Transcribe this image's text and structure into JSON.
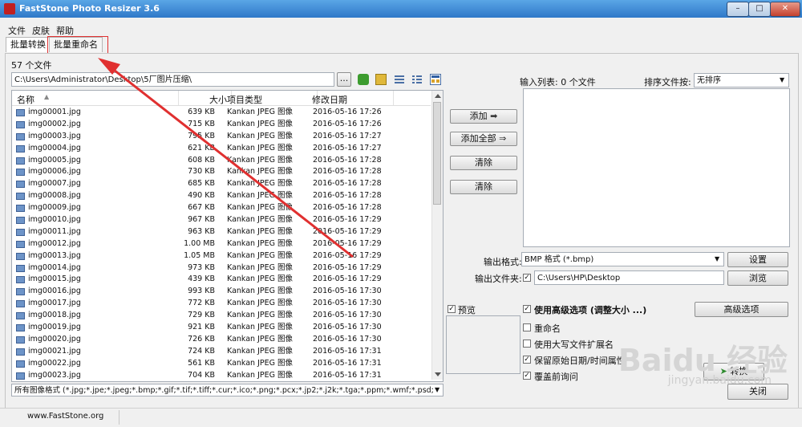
{
  "window": {
    "title": "FastStone Photo Resizer 3.6",
    "minimize": "–",
    "maximize": "□",
    "close": "✕"
  },
  "menu": [
    "文件",
    "皮肤",
    "帮助"
  ],
  "tabs": [
    "批量转换",
    "批量重命名"
  ],
  "left": {
    "file_count": "57 个文件",
    "path": "C:\\Users\\Administrator\\Desktop\\5厂图片压缩\\",
    "browse_label": "...",
    "columns": [
      "名称",
      "大小",
      "项目类型",
      "修改日期"
    ],
    "rows": [
      [
        "img00001.jpg",
        "639 KB",
        "Kankan JPEG 图像",
        "2016-05-16 17:26"
      ],
      [
        "img00002.jpg",
        "715 KB",
        "Kankan JPEG 图像",
        "2016-05-16 17:26"
      ],
      [
        "img00003.jpg",
        "795 KB",
        "Kankan JPEG 图像",
        "2016-05-16 17:27"
      ],
      [
        "img00004.jpg",
        "621 KB",
        "Kankan JPEG 图像",
        "2016-05-16 17:27"
      ],
      [
        "img00005.jpg",
        "608 KB",
        "Kankan JPEG 图像",
        "2016-05-16 17:28"
      ],
      [
        "img00006.jpg",
        "730 KB",
        "Kankan JPEG 图像",
        "2016-05-16 17:28"
      ],
      [
        "img00007.jpg",
        "685 KB",
        "Kankan JPEG 图像",
        "2016-05-16 17:28"
      ],
      [
        "img00008.jpg",
        "490 KB",
        "Kankan JPEG 图像",
        "2016-05-16 17:28"
      ],
      [
        "img00009.jpg",
        "667 KB",
        "Kankan JPEG 图像",
        "2016-05-16 17:28"
      ],
      [
        "img00010.jpg",
        "967 KB",
        "Kankan JPEG 图像",
        "2016-05-16 17:29"
      ],
      [
        "img00011.jpg",
        "963 KB",
        "Kankan JPEG 图像",
        "2016-05-16 17:29"
      ],
      [
        "img00012.jpg",
        "1.00 MB",
        "Kankan JPEG 图像",
        "2016-05-16 17:29"
      ],
      [
        "img00013.jpg",
        "1.05 MB",
        "Kankan JPEG 图像",
        "2016-05-16 17:29"
      ],
      [
        "img00014.jpg",
        "973 KB",
        "Kankan JPEG 图像",
        "2016-05-16 17:29"
      ],
      [
        "img00015.jpg",
        "439 KB",
        "Kankan JPEG 图像",
        "2016-05-16 17:29"
      ],
      [
        "img00016.jpg",
        "993 KB",
        "Kankan JPEG 图像",
        "2016-05-16 17:30"
      ],
      [
        "img00017.jpg",
        "772 KB",
        "Kankan JPEG 图像",
        "2016-05-16 17:30"
      ],
      [
        "img00018.jpg",
        "729 KB",
        "Kankan JPEG 图像",
        "2016-05-16 17:30"
      ],
      [
        "img00019.jpg",
        "921 KB",
        "Kankan JPEG 图像",
        "2016-05-16 17:30"
      ],
      [
        "img00020.jpg",
        "726 KB",
        "Kankan JPEG 图像",
        "2016-05-16 17:30"
      ],
      [
        "img00021.jpg",
        "724 KB",
        "Kankan JPEG 图像",
        "2016-05-16 17:31"
      ],
      [
        "img00022.jpg",
        "561 KB",
        "Kankan JPEG 图像",
        "2016-05-16 17:31"
      ],
      [
        "img00023.jpg",
        "704 KB",
        "Kankan JPEG 图像",
        "2016-05-16 17:31"
      ]
    ],
    "filter": "所有图像格式 (*.jpg;*.jpe;*.jpeg;*.bmp;*.gif;*.tif;*.tiff;*.cur;*.ico;*.png;*.pcx;*.jp2;*.j2k;*.tga;*.ppm;*.wmf;*.psd;"
  },
  "middle": {
    "add": "添加",
    "add_all": "添加全部",
    "clear": "清除",
    "clear_all": "清除",
    "arrow": "➡",
    "arrow2": "⇒"
  },
  "right": {
    "input_list_label": "输入列表: 0 个文件",
    "sort_label": "排序文件按:",
    "sort_value": "无排序",
    "output_format_label": "输出格式:",
    "output_format_value": "BMP 格式 (*.bmp)",
    "settings": "设置",
    "output_folder_label": "输出文件夹:",
    "output_folder_value": "C:\\Users\\HP\\Desktop",
    "browse": "浏览",
    "preview": "预览",
    "advanced_checkbox": "使用高级选项 (调整大小 ...)",
    "advanced_button": "高级选项",
    "rename": "重命名",
    "uppercase_ext": "使用大写文件扩展名",
    "keep_date": "保留原始日期/时间属性",
    "overwrite": "覆盖前询问",
    "convert": "转换",
    "close": "关闭"
  },
  "status": {
    "website": "www.FastStone.org"
  },
  "watermark": {
    "text": "Baidu 经验",
    "sub": "jingyan.baidu.com"
  },
  "colors": {
    "title_bar": "#2f78c8",
    "annotation_red": "#e03030"
  }
}
